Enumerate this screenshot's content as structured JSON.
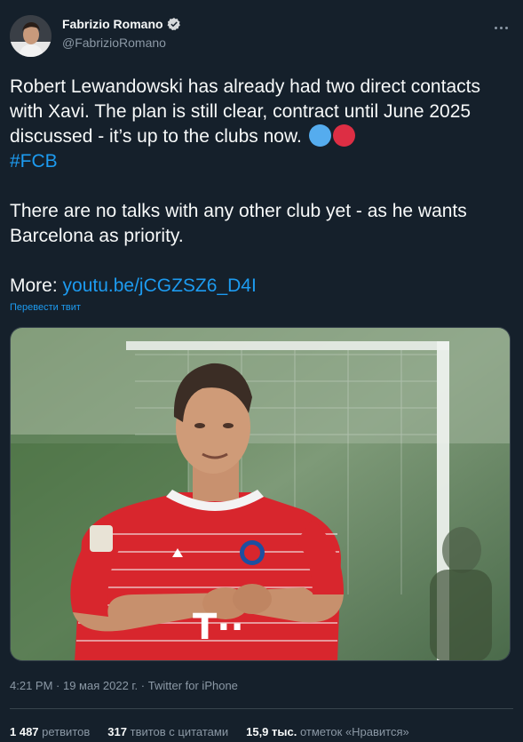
{
  "author": {
    "display_name": "Fabrizio Romano",
    "handle": "@FabrizioRomano",
    "verified": true
  },
  "tweet": {
    "line1": "Robert Lewandowski has already had two direct contacts with Xavi. The plan is still clear, contract until June 2025 discussed - it’s up to the clubs now.",
    "hashtag": "#FCB",
    "paragraph2": "There are no talks with any other club yet - as he wants Barcelona as priority.",
    "more_label": "More:",
    "more_link": "youtu.be/jCGZSZ6_D4I",
    "translate_label": "Перевести твит"
  },
  "emoji": {
    "left_color": "#55acee",
    "right_color": "#dd2e44"
  },
  "media": {
    "kind": "photo",
    "jersey_text": "T··"
  },
  "meta": {
    "time": "4:21 PM",
    "separator1": " · ",
    "date": "19 мая 2022 г.",
    "separator2": " · ",
    "source": "Twitter for iPhone"
  },
  "stats": {
    "retweets_count": "1 487",
    "retweets_label": "ретвитов",
    "quotes_count": "317",
    "quotes_label": "твитов с цитатами",
    "likes_count": "15,9 тыс.",
    "likes_label": "отметок «Нравится»"
  },
  "colors": {
    "background": "#15202b",
    "accent": "#1d9bf0",
    "secondary_text": "#8b98a5"
  }
}
